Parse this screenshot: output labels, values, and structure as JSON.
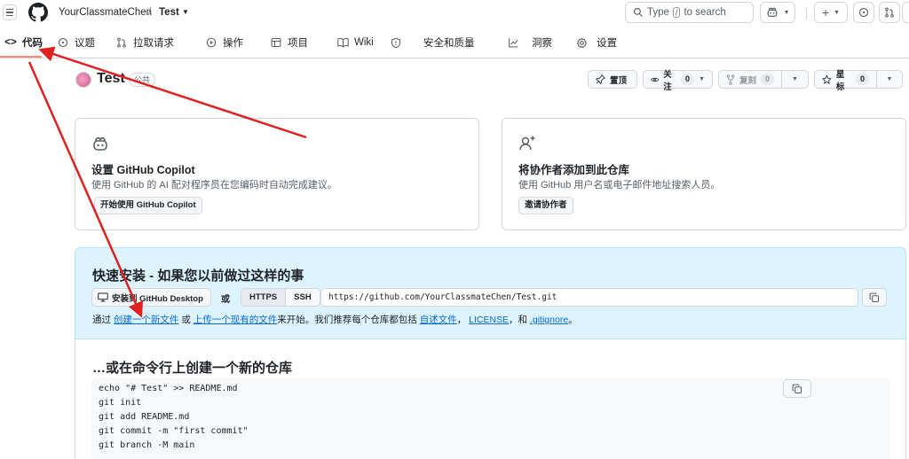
{
  "header": {
    "owner": "YourClassmateChen",
    "separator": "/",
    "repo": "Test",
    "search": {
      "prefix": "Type",
      "key": "/",
      "suffix": "to search"
    }
  },
  "nav": {
    "items": [
      {
        "key": "code",
        "label": "代码",
        "icon": "code-icon"
      },
      {
        "key": "issues",
        "label": "议题",
        "icon": "issue-icon"
      },
      {
        "key": "pulls",
        "label": "拉取请求",
        "icon": "pull-request-icon"
      },
      {
        "key": "actions",
        "label": "操作",
        "icon": "play-icon"
      },
      {
        "key": "projects",
        "label": "项目",
        "icon": "table-icon"
      },
      {
        "key": "wiki",
        "label": "Wiki",
        "icon": "book-icon"
      },
      {
        "key": "security",
        "label": "安全和质量",
        "icon": "shield-icon"
      },
      {
        "key": "insights",
        "label": "洞察",
        "icon": "graph-icon"
      },
      {
        "key": "settings",
        "label": "设置",
        "icon": "gear-icon"
      }
    ],
    "active": "code"
  },
  "repo": {
    "title": "Test",
    "visibility": "公共",
    "pin_label": "置顶",
    "watch_label": "关注",
    "watch_count": "0",
    "fork_label": "复刻",
    "fork_count": "0",
    "star_label": "星标",
    "star_count": "0"
  },
  "cards": {
    "copilot": {
      "title": "设置 GitHub Copilot",
      "desc": "使用 GitHub 的 AI 配对程序员在您编码时自动完成建议。",
      "button": "开始使用 GitHub Copilot"
    },
    "collab": {
      "title": "将协作者添加到此仓库",
      "desc": "使用 GitHub 用户名或电子邮件地址搜索人员。",
      "button": "邀请协作者"
    }
  },
  "quick_setup": {
    "title": "快速安装 - 如果您以前做过这样的事",
    "desktop_button": "安装到 GitHub Desktop",
    "or": "或",
    "protocols": [
      "HTTPS",
      "SSH"
    ],
    "selected_protocol": "HTTPS",
    "url": "https://github.com/YourClassmateChen/Test.git",
    "help": {
      "p1": "通过 ",
      "link_new": "创建一个新文件",
      "p2": " 或 ",
      "link_upload": "上传一个现有的文件",
      "p3": "来开始。我们推荐每个仓库都包括 ",
      "link_readme": "自述文件",
      "p4": "， ",
      "link_license": "LICENSE",
      "p5": "，和 ",
      "link_gitignore": ".gitignore",
      "p6": "。"
    }
  },
  "command_line": {
    "title": "…或在命令行上创建一个新的仓库",
    "lines": [
      "echo \"# Test\" >> README.md",
      "git init",
      "git add README.md",
      "git commit -m \"first commit\"",
      "git branch -M main"
    ]
  },
  "colors": {
    "accent_link": "#0969da",
    "active_tab_underline": "#fd8c73",
    "quick_setup_bg": "#ddf4ff",
    "annotation_arrow": "#e02020"
  }
}
